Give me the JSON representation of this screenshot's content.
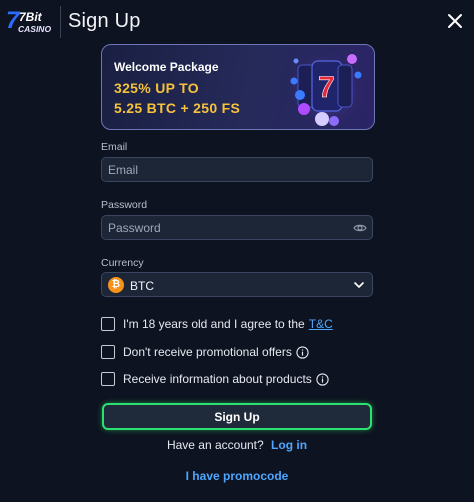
{
  "header": {
    "logo_text_top": "7Bit",
    "logo_text_bottom": "CASINO",
    "title": "Sign Up"
  },
  "banner": {
    "title": "Welcome Package",
    "line1": "325% UP TO",
    "line2": "5.25 BTC + 250 FS"
  },
  "form": {
    "email": {
      "label": "Email",
      "placeholder": "Email",
      "value": ""
    },
    "password": {
      "label": "Password",
      "placeholder": "Password",
      "value": ""
    },
    "currency": {
      "label": "Currency",
      "selected": "BTC",
      "symbol": "₿"
    }
  },
  "checkboxes": [
    {
      "label": "I'm 18 years old and I agree to the",
      "link": "T&C",
      "checked": false
    },
    {
      "label": "Don't receive promotional offers",
      "checked": false
    },
    {
      "label": "Receive information about products",
      "checked": false
    }
  ],
  "submit_label": "Sign Up",
  "account": {
    "text": "Have an account?",
    "link": "Log in"
  },
  "promo_link": "I have promocode",
  "colors": {
    "background": "#0d1320",
    "accent_green": "#2ee06f",
    "link_blue": "#4ea6ff",
    "bonus_gold": "#f5c33b",
    "btc_orange": "#f7931a"
  },
  "icons": {
    "close": "close-icon",
    "eye": "eye-icon",
    "chevron": "chevron-down-icon",
    "info": "info-icon",
    "btc": "btc-icon"
  }
}
